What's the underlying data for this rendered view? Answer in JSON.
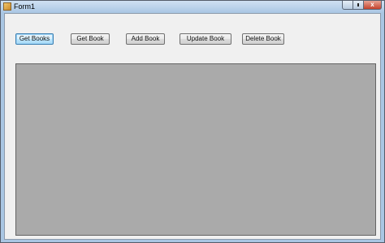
{
  "window": {
    "title": "Form1",
    "app_icon": "form-app-icon"
  },
  "caption_buttons": {
    "minimize_icon": "minimize-icon",
    "maximize_icon": "maximize-icon",
    "close_icon": "close-icon",
    "close_glyph": "x"
  },
  "toolbar": {
    "get_books": "Get Books",
    "get_book": "Get Book",
    "add_book": "Add Book",
    "update_book": "Update Book",
    "delete_book": "Delete Book"
  },
  "grid": {
    "background": "#aaaaaa",
    "rows": []
  },
  "colors": {
    "client_background": "#f0f0f0",
    "frame": "#a9c6e3",
    "focus_border": "#3c7fb1"
  }
}
